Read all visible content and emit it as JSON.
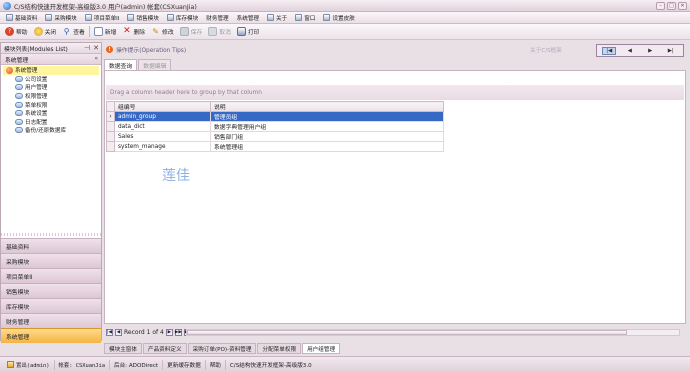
{
  "window": {
    "title": "C/S结构快速开发框架-高级版3.0 用户(admin) 帐套(CSXuanJia)"
  },
  "menu": [
    {
      "label": "基础资料",
      "icon": "folder-icon"
    },
    {
      "label": "采购模块",
      "icon": "folder-icon"
    },
    {
      "label": "项目菜单II",
      "icon": "folder-icon"
    },
    {
      "label": "销售模块",
      "icon": "folder-icon"
    },
    {
      "label": "库存模块",
      "icon": "folder-icon"
    },
    {
      "label": "财务管理",
      "icon": "folder-icon"
    },
    {
      "label": "系统管理",
      "icon": "folder-icon"
    },
    {
      "label": "关于",
      "icon": "info-icon"
    },
    {
      "label": "窗口",
      "icon": "window-icon"
    },
    {
      "label": "设置皮肤",
      "icon": "skin-icon"
    }
  ],
  "toolbar": {
    "help": "帮助",
    "close": "关闭",
    "view": "查看",
    "add": "新增",
    "delete": "删除",
    "edit": "修改",
    "save": "保存",
    "cancel": "取消",
    "print": "打印"
  },
  "left_panel": {
    "header": "模块列表(Modules List)",
    "module_title": "系统管理",
    "tree_root": "系统管理",
    "tree_items": [
      "公司设置",
      "用户管理",
      "权限管理",
      "菜单权限",
      "系统设置",
      "日志配置",
      "备份/还原数据库"
    ],
    "modules": [
      "基础资料",
      "采购模块",
      "项目菜单II",
      "销售模块",
      "库存模块",
      "财务管理",
      "系统管理"
    ],
    "active_module": "系统管理"
  },
  "main": {
    "tips": "操作提示(Operation Tips)",
    "about_link": "关于C/S框架",
    "tabs": [
      "数据查询",
      "数据编辑"
    ],
    "active_tab": "数据查询",
    "group_hint": "Drag a column header here to group by that column",
    "columns": [
      "组编号",
      "说明"
    ],
    "rows": [
      [
        "admin_group",
        "管理员组"
      ],
      [
        "data_dict",
        "数据字典管理用户组"
      ],
      [
        "Sales",
        "销售部门组"
      ],
      [
        "system_manage",
        "系统管理组"
      ]
    ],
    "selected_row": 0,
    "watermark": "莲佳",
    "pager_text": "Record 1 of 4"
  },
  "doc_tabs": [
    "模块主窗体",
    "产品资料定义",
    "采购订单(PO)-资料管理",
    "分配菜单权限",
    "用户组管理"
  ],
  "active_doc_tab": "用户组管理",
  "status": {
    "logout": "置出(admin)",
    "account": "帐套: CSXuanJia",
    "backend": "后台: ADODirect",
    "update_cache": "更新缓存数据",
    "help": "帮助",
    "version": "C/S结构快速开发框架-高级版3.0"
  }
}
